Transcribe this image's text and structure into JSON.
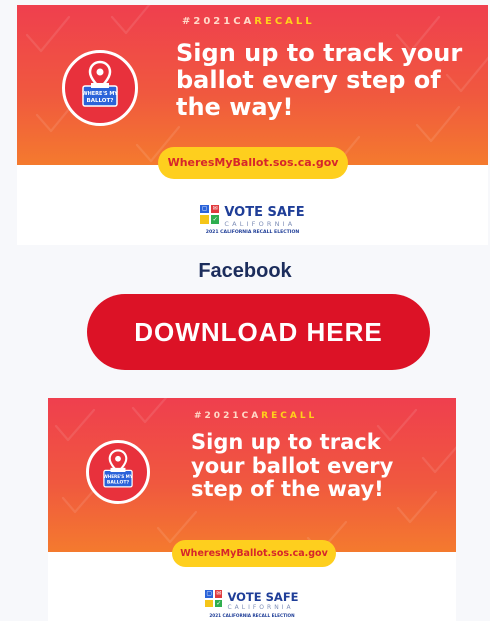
{
  "banners": [
    {
      "hashtag_prefix": "#2021CA",
      "hashtag_highlight": "RECALL",
      "headline_lines": [
        "Sign up to track your",
        "ballot every step of",
        "the way!"
      ],
      "logo_text_1": "WHERE'S MY",
      "logo_text_2": "BALLOT?",
      "url": "WheresMyBallot.sos.ca.gov",
      "vote_title": "VOTE SAFE",
      "vote_state": "CALIFORNIA",
      "vote_sub": "2021 CALIFORNIA RECALL ELECTION"
    },
    {
      "hashtag_prefix": "#2021CA",
      "hashtag_highlight": "RECALL",
      "headline_lines": [
        "Sign up to track",
        "your ballot every",
        "step of the way!"
      ],
      "logo_text_1": "WHERE'S MY",
      "logo_text_2": "BALLOT?",
      "url": "WheresMyBallot.sos.ca.gov",
      "vote_title": "VOTE SAFE",
      "vote_state": "CALIFORNIA",
      "vote_sub": "2021 CALIFORNIA RECALL ELECTION"
    }
  ],
  "section": {
    "label": "Facebook",
    "download_label": "DOWNLOAD HERE"
  },
  "colors": {
    "banner_gradient_top": "#ef3f4e",
    "banner_gradient_bottom": "#f47a2e",
    "url_pill": "#fecf1e",
    "download_button": "#dc1226",
    "heading_text": "#1c2d5c",
    "vote_blue": "#1f3e98"
  },
  "icons": {
    "logo": "ballot-box-location-icon",
    "vote_safe": "vote-safe-squares-icon"
  }
}
